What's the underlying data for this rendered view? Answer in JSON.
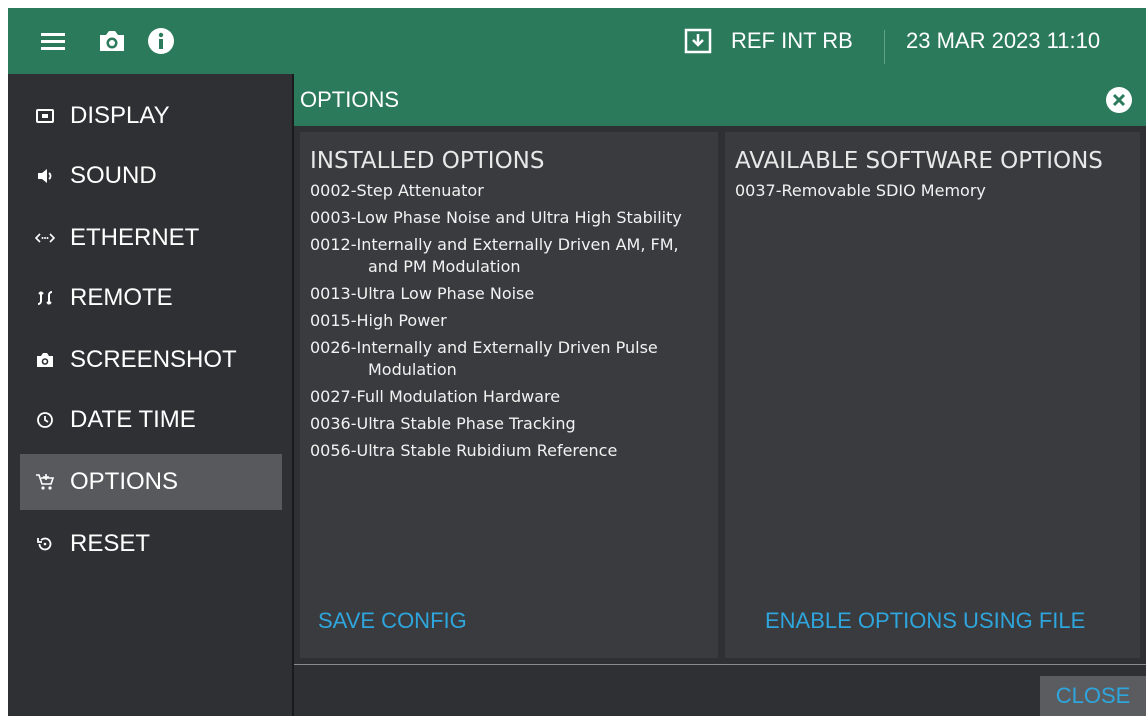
{
  "topbar": {
    "icons": [
      "menu-icon",
      "camera-icon",
      "info-icon",
      "download-icon"
    ],
    "reference": "REF INT RB",
    "datetime": "23 MAR 2023 11:10"
  },
  "sidebar": {
    "items": [
      {
        "label": "DISPLAY",
        "icon": "display-icon"
      },
      {
        "label": "SOUND",
        "icon": "sound-icon"
      },
      {
        "label": "ETHERNET",
        "icon": "ethernet-icon"
      },
      {
        "label": "REMOTE",
        "icon": "remote-icon"
      },
      {
        "label": "SCREENSHOT",
        "icon": "camera-icon"
      },
      {
        "label": "DATE TIME",
        "icon": "clock-icon"
      },
      {
        "label": "OPTIONS",
        "icon": "options-icon",
        "active": true
      },
      {
        "label": "RESET",
        "icon": "reset-icon"
      }
    ]
  },
  "options": {
    "title": "OPTIONS",
    "installed_title": "INSTALLED OPTIONS",
    "installed": [
      "0002-Step Attenuator",
      "0003-Low Phase Noise and Ultra High Stability",
      "0012-Internally and Externally Driven AM, FM, and PM Modulation",
      "0013-Ultra Low Phase Noise",
      "0015-High Power",
      "0026-Internally and Externally Driven Pulse Modulation",
      "0027-Full Modulation Hardware",
      "0036-Ultra Stable Phase Tracking",
      "0056-Ultra Stable Rubidium Reference"
    ],
    "available_title": "AVAILABLE SOFTWARE OPTIONS",
    "available": [
      "0037-Removable SDIO Memory"
    ],
    "save_config": "SAVE CONFIG",
    "enable_options": "ENABLE OPTIONS USING FILE",
    "close": "CLOSE"
  },
  "colors": {
    "header_green": "#2b7a5c",
    "panel_bg": "#3a3b3e",
    "sidebar_bg": "#2f3033",
    "active_item": "#57595d",
    "link_blue": "#2ea6dd"
  }
}
